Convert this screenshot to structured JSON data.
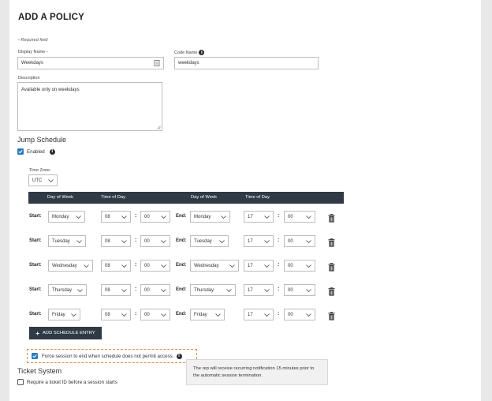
{
  "page": {
    "title": "ADD A POLICY",
    "required_note": "Required field",
    "required_marker": "•"
  },
  "form": {
    "display_name": {
      "label": "Display Name",
      "value": "Weekdays"
    },
    "code_name": {
      "label": "Code Name",
      "value": "weekdays"
    },
    "description": {
      "label": "Description",
      "value": "Available only on weekdays"
    }
  },
  "jump_schedule": {
    "heading": "Jump Schedule",
    "enabled_label": "Enabled",
    "enabled": true,
    "time_zone": {
      "label": "Time Zone:",
      "value": "UTC"
    },
    "headers": {
      "day_of_week": "Day of Week",
      "time_of_day": "Time of Day"
    },
    "start_label": "Start:",
    "end_label": "End:",
    "entries": [
      {
        "start_day": "Monday",
        "start_hour": "08",
        "start_min": "00",
        "end_day": "Monday",
        "end_hour": "17",
        "end_min": "00"
      },
      {
        "start_day": "Tuesday",
        "start_hour": "08",
        "start_min": "00",
        "end_day": "Tuesday",
        "end_hour": "17",
        "end_min": "00"
      },
      {
        "start_day": "Wednesday",
        "start_hour": "08",
        "start_min": "00",
        "end_day": "Wednesday",
        "end_hour": "17",
        "end_min": "00"
      },
      {
        "start_day": "Thursday",
        "start_hour": "08",
        "start_min": "00",
        "end_day": "Thursday",
        "end_hour": "17",
        "end_min": "00"
      },
      {
        "start_day": "Friday",
        "start_hour": "08",
        "start_min": "00",
        "end_day": "Friday",
        "end_hour": "17",
        "end_min": "00"
      }
    ],
    "add_button": "ADD SCHEDULE ENTRY",
    "force_end_label": "Force session to end when schedule does not permit access.",
    "force_end": true,
    "tooltip": "The rep will receive recurring notification 15 minutes prior to the automatic session termination."
  },
  "ticket_system": {
    "heading": "Ticket System",
    "require_label": "Require a ticket ID before a session starts",
    "require": false
  },
  "colors": {
    "accent": "#2a7ab8",
    "header_bg": "#303a44",
    "required": "#e0702e"
  },
  "icons": {
    "info": "info-icon",
    "chevron": "chevron-down-icon",
    "trash": "trash-icon",
    "check": "check-icon",
    "id_card": "contact-card-icon"
  }
}
